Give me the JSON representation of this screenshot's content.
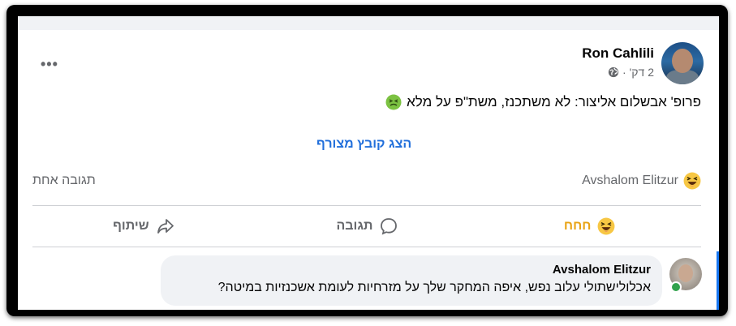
{
  "post": {
    "author": "Ron Cahlili",
    "time": "2 דק'",
    "separator": "·",
    "privacy_icon": "globe-icon",
    "more_label": "•••",
    "text": "פרופ' אבשלום אליצור: לא משתכנז, משת\"פ על מלא",
    "text_emoji": "nauseated-face-icon",
    "attachment_link": "הצג קובץ מצורף"
  },
  "reactions": {
    "reactor": "Avshalom Elitzur",
    "reaction_icon": "haha-emoji-icon",
    "comment_count": "תגובה אחת"
  },
  "actions": {
    "haha_label": "חחח",
    "comment_label": "תגובה",
    "share_label": "שיתוף"
  },
  "comment": {
    "author": "Avshalom Elitzur",
    "text": "אכלולישתולי עלוב נפש, איפה המחקר שלך על מזרחיות לעומת אשכנזיות במיטה?",
    "online_status": "online"
  },
  "colors": {
    "link_blue": "#216fdb",
    "haha_yellow": "#e9a314",
    "secondary_text": "#65676b",
    "bubble_bg": "#f0f2f5",
    "online_green": "#31a24c"
  }
}
